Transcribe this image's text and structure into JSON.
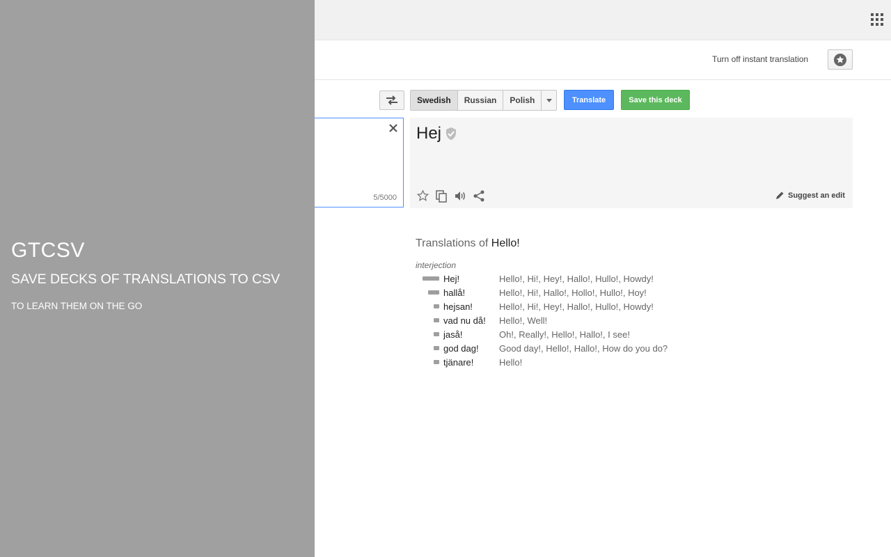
{
  "header": {
    "apps_icon": "apps-grid-icon"
  },
  "toolbar": {
    "instant_translation_label": "Turn off instant translation",
    "phrasebook_icon": "star-icon"
  },
  "languages": {
    "swap_icon": "swap-arrows-icon",
    "target": [
      "Swedish",
      "Russian",
      "Polish"
    ],
    "selected": "Swedish",
    "more_icon": "chevron-down-icon"
  },
  "actions": {
    "translate_label": "Translate",
    "save_deck_label": "Save this deck"
  },
  "source": {
    "char_count": "5/5000",
    "clear_icon": "close-icon"
  },
  "result": {
    "text": "Hej",
    "verified_icon": "verified-shield-icon",
    "icons": [
      "star-outline-icon",
      "copy-icon",
      "speaker-icon",
      "share-icon"
    ],
    "suggest_label": "Suggest an edit"
  },
  "translations": {
    "title_prefix": "Translations of",
    "query": "Hello!",
    "part_of_speech": "interjection",
    "rows": [
      {
        "word": "Hej!",
        "frequency": 3,
        "synonyms": [
          "Hello!",
          "Hi!",
          "Hey!",
          "Hallo!",
          "Hullo!",
          "Howdy!"
        ]
      },
      {
        "word": "hallå!",
        "frequency": 2,
        "synonyms": [
          "Hello!",
          "Hi!",
          "Hallo!",
          "Hollo!",
          "Hullo!",
          "Hoy!"
        ]
      },
      {
        "word": "hejsan!",
        "frequency": 1,
        "synonyms": [
          "Hello!",
          "Hi!",
          "Hey!",
          "Hallo!",
          "Hullo!",
          "Howdy!"
        ]
      },
      {
        "word": "vad nu då!",
        "frequency": 1,
        "synonyms": [
          "Hello!",
          "Well!"
        ]
      },
      {
        "word": "jaså!",
        "frequency": 1,
        "synonyms": [
          "Oh!",
          "Really!",
          "Hello!",
          "Hallo!",
          "I see!"
        ]
      },
      {
        "word": "god dag!",
        "frequency": 1,
        "synonyms": [
          "Good day!",
          "Hello!",
          "Hallo!",
          "How do you do?"
        ]
      },
      {
        "word": "tjänare!",
        "frequency": 1,
        "synonyms": [
          "Hello!"
        ]
      }
    ]
  },
  "overlay": {
    "title": "GTCSV",
    "subtitle": "SAVE DECKS OF TRANSLATIONS TO CSV",
    "tagline": "TO LEARN THEM ON THE GO"
  }
}
